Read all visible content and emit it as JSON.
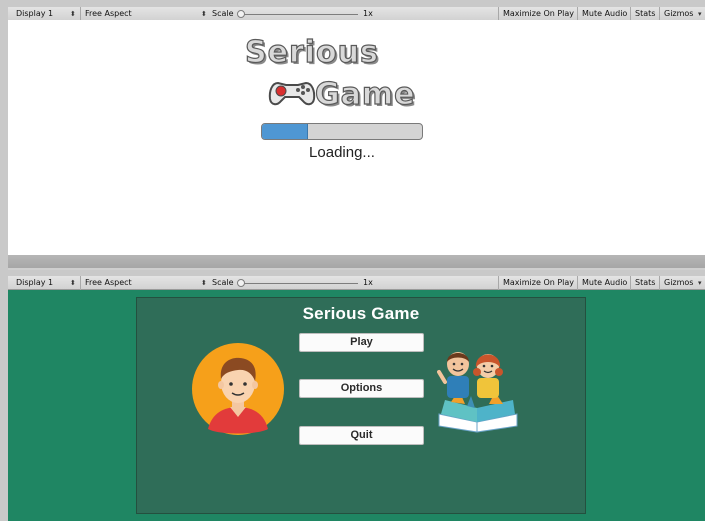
{
  "toolbar_top": {
    "display": "Display 1",
    "aspect": "Free Aspect",
    "scale_label": "Scale",
    "scale_value": "1x",
    "maximize": "Maximize On Play",
    "mute": "Mute Audio",
    "stats": "Stats",
    "gizmos": "Gizmos"
  },
  "loading_screen": {
    "logo_line1": "Serious",
    "logo_line2": "Game",
    "progress": 0.29,
    "loading_text": "Loading..."
  },
  "toolbar_bottom": {
    "display": "Display 1",
    "aspect": "Free Aspect",
    "scale_label": "Scale",
    "scale_value": "1x",
    "maximize": "Maximize On Play",
    "mute": "Mute Audio",
    "stats": "Stats",
    "gizmos": "Gizmos"
  },
  "menu": {
    "title": "Serious Game",
    "buttons": [
      "Play",
      "Options",
      "Quit"
    ]
  },
  "colors": {
    "menu_bg": "#1f8663",
    "panel_bg": "#2f6d58",
    "progress_fill": "#4f97d3"
  }
}
